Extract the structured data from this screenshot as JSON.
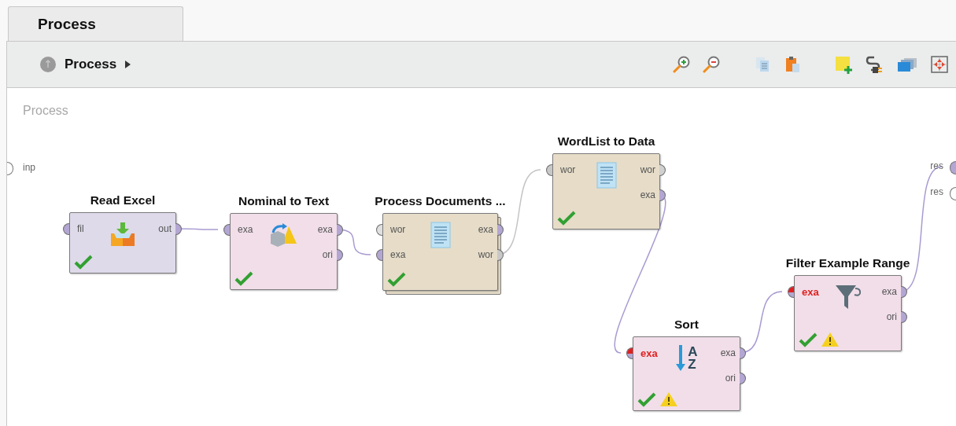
{
  "tabs": [
    {
      "label": "Process",
      "selected": true
    }
  ],
  "breadcrumb": {
    "label": "Process"
  },
  "canvas": {
    "label": "Process",
    "process_inputs": [
      {
        "label": "inp",
        "color": "#ffffff"
      }
    ],
    "process_outputs": [
      {
        "label": "res",
        "color": "#b3a6d3"
      },
      {
        "label": "res",
        "color": "#ffffff"
      }
    ],
    "operators": [
      {
        "name": "Read Excel",
        "kind": "excel",
        "color": "#dedaea",
        "stacked": false,
        "ok": true,
        "warning": false,
        "inputs": [
          {
            "label": "fil",
            "color": "#b3a6d3",
            "error": false
          }
        ],
        "outputs": [
          {
            "label": "out",
            "color": "#b3a6d3"
          }
        ]
      },
      {
        "name": "Nominal to Text",
        "kind": "convert",
        "color": "#f1dee9",
        "stacked": false,
        "ok": true,
        "warning": false,
        "inputs": [
          {
            "label": "exa",
            "color": "#b3a6d3",
            "error": false
          }
        ],
        "outputs": [
          {
            "label": "exa",
            "color": "#b3a6d3"
          },
          {
            "label": "ori",
            "color": "#b3a6d3"
          }
        ]
      },
      {
        "name": "Process Documents ...",
        "kind": "document",
        "color": "#e6dcc8",
        "stacked": true,
        "ok": true,
        "warning": false,
        "inputs": [
          {
            "label": "wor",
            "color": "#e0e0e0",
            "error": false
          },
          {
            "label": "exa",
            "color": "#b3a6d3",
            "error": false
          }
        ],
        "outputs": [
          {
            "label": "exa",
            "color": "#b3a6d3"
          },
          {
            "label": "wor",
            "color": "#c8c8c8"
          }
        ]
      },
      {
        "name": "WordList to Data",
        "kind": "document",
        "color": "#e6dcc8",
        "stacked": false,
        "ok": true,
        "warning": false,
        "inputs": [
          {
            "label": "wor",
            "color": "#c8c8c8",
            "error": false
          }
        ],
        "outputs": [
          {
            "label": "wor",
            "color": "#d0d0d0"
          },
          {
            "label": "exa",
            "color": "#b3a6d3"
          }
        ]
      },
      {
        "name": "Sort",
        "kind": "sort",
        "icon_letters": [
          "A",
          "Z"
        ],
        "color": "#f1dee9",
        "stacked": false,
        "ok": true,
        "warning": true,
        "inputs": [
          {
            "label": "exa",
            "color": "#b3a6d3",
            "error": true
          }
        ],
        "outputs": [
          {
            "label": "exa",
            "color": "#b3a6d3"
          },
          {
            "label": "ori",
            "color": "#b3a6d3"
          }
        ]
      },
      {
        "name": "Filter Example Range",
        "kind": "filter",
        "color": "#f1dee9",
        "stacked": false,
        "ok": true,
        "warning": true,
        "inputs": [
          {
            "label": "exa",
            "color": "#b3a6d3",
            "error": true
          }
        ],
        "outputs": [
          {
            "label": "exa",
            "color": "#b3a6d3"
          },
          {
            "label": "ori",
            "color": "#b3a6d3"
          }
        ]
      }
    ],
    "connections": [
      {
        "color": "#a99bd1"
      },
      {
        "color": "#a99bd1"
      },
      {
        "color": "#c4c4c4"
      },
      {
        "color": "#a99bd1"
      },
      {
        "color": "#a99bd1"
      },
      {
        "color": "#a99bd1"
      }
    ]
  }
}
